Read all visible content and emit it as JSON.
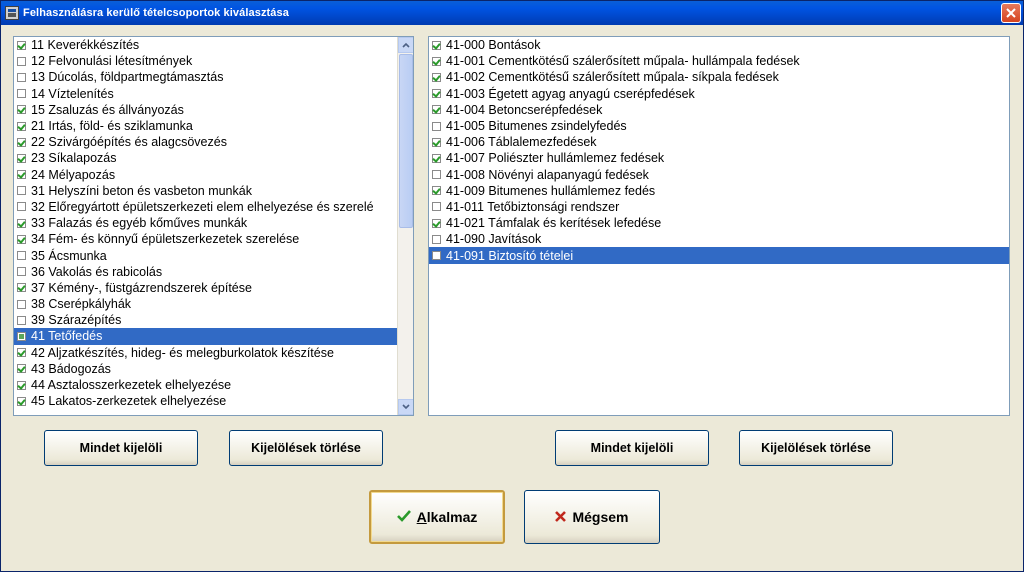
{
  "window": {
    "title": "Felhasználásra kerülő tételcsoportok kiválasztása"
  },
  "left_list": {
    "items": [
      {
        "label": "11 Keverékkészítés",
        "checked": "on"
      },
      {
        "label": "12 Felvonulási létesítmények",
        "checked": "off"
      },
      {
        "label": "13 Dúcolás, földpartmegtámasztás",
        "checked": "off"
      },
      {
        "label": "14 Víztelenítés",
        "checked": "off"
      },
      {
        "label": "15 Zsaluzás és állványozás",
        "checked": "on"
      },
      {
        "label": "21 Irtás, föld- és sziklamunka",
        "checked": "on"
      },
      {
        "label": "22 Szivárgóépítés és alagcsövezés",
        "checked": "on"
      },
      {
        "label": "23 Síkalapozás",
        "checked": "on"
      },
      {
        "label": "24 Mélyapozás",
        "checked": "on"
      },
      {
        "label": "31 Helyszíni beton és vasbeton munkák",
        "checked": "off"
      },
      {
        "label": "32 Előregyártott épületszerkezeti elem elhelyezése és szerelé",
        "checked": "off"
      },
      {
        "label": "33 Falazás és egyéb kőműves munkák",
        "checked": "on"
      },
      {
        "label": "34 Fém- és könnyű épületszerkezetek szerelése",
        "checked": "on"
      },
      {
        "label": "35 Ácsmunka",
        "checked": "off"
      },
      {
        "label": "36 Vakolás és rabicolás",
        "checked": "off"
      },
      {
        "label": "37 Kémény-, füstgázrendszerek építése",
        "checked": "on"
      },
      {
        "label": "38 Cserépkályhák",
        "checked": "off"
      },
      {
        "label": "39 Szárazépítés",
        "checked": "off"
      },
      {
        "label": "41 Tetőfedés",
        "checked": "partial",
        "selected": true
      },
      {
        "label": "42 Aljzatkészítés, hideg- és melegburkolatok készítése",
        "checked": "on"
      },
      {
        "label": "43 Bádogozás",
        "checked": "on"
      },
      {
        "label": "44 Asztalosszerkezetek elhelyezése",
        "checked": "on"
      },
      {
        "label": "45 Lakatos-zerkezetek elhelyezése",
        "checked": "on"
      }
    ]
  },
  "right_list": {
    "items": [
      {
        "label": "41-000 Bontások",
        "checked": "on"
      },
      {
        "label": "41-001 Cementkötésű szálerősített műpala- hullámpala fedések",
        "checked": "on"
      },
      {
        "label": "41-002 Cementkötésű szálerősített műpala- síkpala fedések",
        "checked": "on"
      },
      {
        "label": "41-003 Égetett agyag anyagú cserépfedések",
        "checked": "on"
      },
      {
        "label": "41-004 Betoncserépfedések",
        "checked": "on"
      },
      {
        "label": "41-005 Bitumenes zsindelyfedés",
        "checked": "off"
      },
      {
        "label": "41-006 Táblalemezfedések",
        "checked": "on"
      },
      {
        "label": "41-007 Poliészter hullámlemez fedések",
        "checked": "on"
      },
      {
        "label": "41-008 Növényi alapanyagú fedések",
        "checked": "off"
      },
      {
        "label": "41-009 Bitumenes hullámlemez fedés",
        "checked": "on"
      },
      {
        "label": "41-011 Tetőbiztonsági rendszer",
        "checked": "off"
      },
      {
        "label": "41-021 Támfalak és kerítések lefedése",
        "checked": "on"
      },
      {
        "label": "41-090 Javítások",
        "checked": "off"
      },
      {
        "label": "41-091 Biztosító tételei",
        "checked": "off",
        "selected": true
      }
    ]
  },
  "buttons": {
    "left_select_all": "Mindet kijelöli",
    "left_clear": "Kijelölések törlése",
    "right_select_all": "Mindet kijelöli",
    "right_clear": "Kijelölések törlése",
    "apply_prefix": "A",
    "apply_rest": "lkalmaz",
    "cancel": "Mégsem"
  },
  "icons": {
    "title": "app-icon",
    "close": "close-icon",
    "apply": "checkmark-icon",
    "cancel": "x-icon"
  },
  "colors": {
    "title_bar": "#0054e3",
    "selection": "#316ac5",
    "check": "#2a9a2a",
    "cancel_x": "#c0281c"
  }
}
